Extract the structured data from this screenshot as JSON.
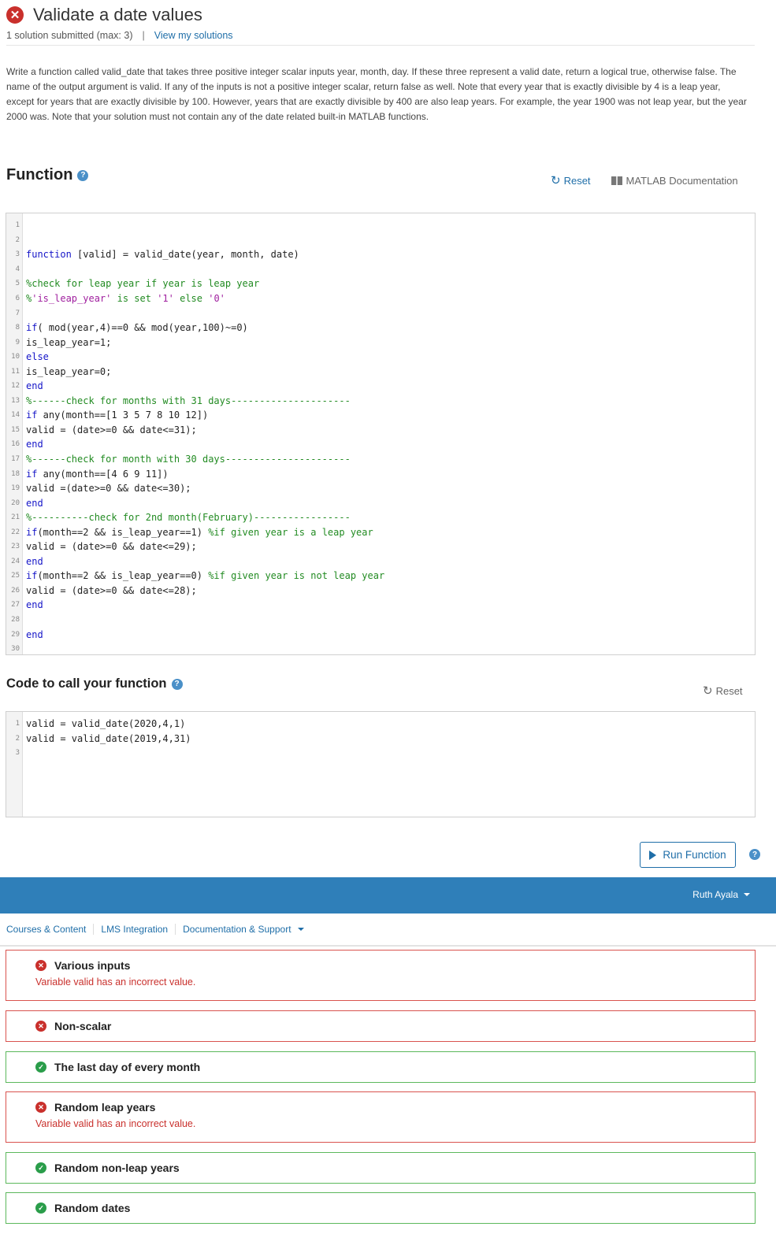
{
  "header": {
    "title": "Validate a date values",
    "submitted": "1 solution submitted (max: 3)",
    "separator": "|",
    "view_link": "View my solutions"
  },
  "description": "Write a function called valid_date that takes three positive integer scalar inputs year, month, day. If these three represent a valid date, return a logical true, otherwise false. The name of the output argument is valid. If any of the inputs is not a positive integer scalar, return false as well. Note that every year that is exactly divisible by 4 is a leap year, except for years that are exactly divisible by 100. However, years that are exactly divisible by 400 are also leap years. For example, the year 1900 was not leap year, but the year 2000 was. Note that your solution must not contain any of the date related built-in MATLAB functions.",
  "function_section": {
    "heading": "Function",
    "help": "?",
    "reset_label": "Reset",
    "doc_label": "MATLAB Documentation"
  },
  "function_code": [
    "",
    "",
    "function [valid] = valid_date(year, month, date)",
    "",
    "%check for leap year if year is leap year",
    "%'is_leap_year' is set '1' else '0'",
    "",
    "if( mod(year,4)==0 && mod(year,100)~=0)",
    "is_leap_year=1;",
    "else",
    "is_leap_year=0;",
    "end",
    "%------check for months with 31 days---------------------",
    "if any(month==[1 3 5 7 8 10 12])",
    "valid = (date>=0 && date<=31);",
    "end",
    "%------check for month with 30 days----------------------",
    "if any(month==[4 6 9 11])",
    "valid =(date>=0 && date<=30);",
    "end",
    "%----------check for 2nd month(February)-----------------",
    "if(month==2 && is_leap_year==1) %if given year is a leap year",
    "valid = (date>=0 && date<=29);",
    "end",
    "if(month==2 && is_leap_year==0) %if given year is not leap year",
    "valid = (date>=0 && date<=28);",
    "end",
    "",
    "end",
    ""
  ],
  "call_section": {
    "heading": "Code to call your function",
    "help": "?",
    "reset_label": "Reset"
  },
  "call_code": [
    "valid = valid_date(2020,4,1)",
    "valid = valid_date(2019,4,31)",
    ""
  ],
  "run_button": "Run Function",
  "run_help": "?",
  "topbar": {
    "user": "Ruth Ayala"
  },
  "nav": {
    "courses": "Courses & Content",
    "lms": "LMS Integration",
    "docs": "Documentation & Support"
  },
  "tests": [
    {
      "status": "fail",
      "icon": "x-circle-icon",
      "glyph": "✕",
      "name": "Various inputs",
      "message": "Variable valid has an incorrect value."
    },
    {
      "status": "fail",
      "icon": "x-circle-icon",
      "glyph": "✕",
      "name": "Non-scalar",
      "message": ""
    },
    {
      "status": "pass",
      "icon": "check-circle-icon",
      "glyph": "✓",
      "name": "The last day of every month",
      "message": ""
    },
    {
      "status": "fail",
      "icon": "x-circle-icon",
      "glyph": "✕",
      "name": "Random leap years",
      "message": "Variable valid has an incorrect value."
    },
    {
      "status": "pass",
      "icon": "check-circle-icon",
      "glyph": "✓",
      "name": "Random non-leap years",
      "message": ""
    },
    {
      "status": "pass",
      "icon": "check-circle-icon",
      "glyph": "✓",
      "name": "Random dates",
      "message": ""
    }
  ],
  "colors": {
    "fail": "#c9302c",
    "pass": "#2a9d4a",
    "accent": "#1f6ea8",
    "topbar": "#2f7fb9"
  }
}
